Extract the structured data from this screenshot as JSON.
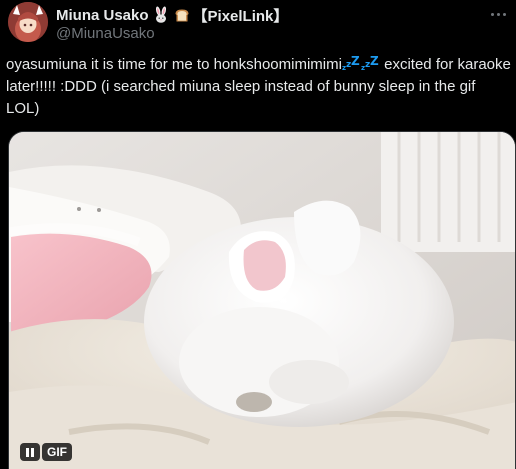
{
  "author": {
    "display_name": "Miuna Usako",
    "tag": "【PixelLink】",
    "handle": "@MiunaUsako",
    "emoji_icons": [
      "rabbit-emoji",
      "bread-emoji"
    ]
  },
  "tweet": {
    "text_before": "oyasumiuna it is time for me to honkshoomimimimi",
    "text_after": " excited for karaoke later!!!!! :DDD (i searched miuna sleep instead of bunny sleep in the gif LOL)",
    "inline_emoji": "zzz-emoji"
  },
  "media": {
    "badge": "GIF",
    "image_description_icon": "sleeping-bunny-image"
  },
  "colors": {
    "background": "#000000",
    "text": "#e7e9ea",
    "secondary": "#71767b",
    "zzz": "#1d9bf0"
  }
}
